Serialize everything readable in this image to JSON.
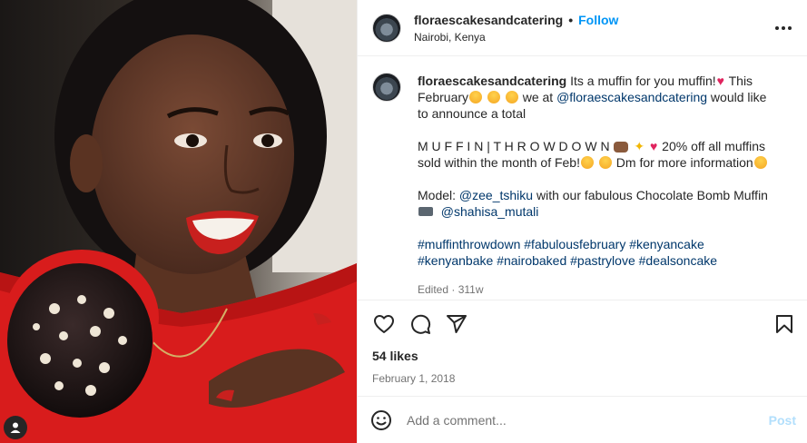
{
  "header": {
    "username": "floraescakesandcatering",
    "separator": "•",
    "follow_label": "Follow",
    "location": "Nairobi, Kenya",
    "more_icon": "more-horizontal-icon"
  },
  "caption": {
    "username": "floraescakesandcatering",
    "line1_a": "Its a muffin for you muffin!",
    "line1_b": " This February",
    "line1_c": " we at ",
    "mention_brand": "@floraescakesandcatering",
    "line1_d": " would like to announce a total",
    "line2_a": "M U F F I N | T H R O W D O W N ",
    "line2_b": " 20% off all muffins sold within the month of Feb!",
    "line2_c": " Dm for more information",
    "line3_a": "Model: ",
    "mention_model": "@zee_tshiku",
    "line3_b": " with our fabulous Chocolate Bomb Muffin",
    "mention_photographer": "@shahisa_mutali",
    "hashtags": [
      "#muffinthrowdown",
      "#fabulousfebruary",
      "#kenyancake",
      "#kenyanbake",
      "#nairobaked",
      "#pastrylove",
      "#dealsoncake"
    ],
    "meta_edited": "Edited",
    "meta_sep": " · ",
    "meta_age": "311w"
  },
  "actions": {
    "like_icon": "heart-icon",
    "comment_icon": "comment-icon",
    "share_icon": "share-icon",
    "save_icon": "bookmark-icon"
  },
  "likes": "54 likes",
  "date": "February 1, 2018",
  "comment": {
    "emoji_icon": "emoji-icon",
    "placeholder": "Add a comment...",
    "post_label": "Post"
  },
  "colors": {
    "accent": "#0095f6",
    "link": "#00376b",
    "muted": "#737373",
    "post_disabled": "#b2dffc"
  }
}
